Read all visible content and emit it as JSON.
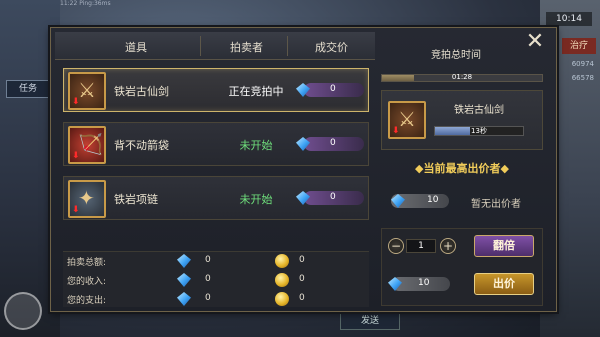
{
  "background": {
    "status_text": "11:22  Ping:36ms",
    "clock": "10:14",
    "side_button": "任务",
    "right_tab": "治疗",
    "num_a": "60974",
    "num_b": "66578",
    "send_label": "发送"
  },
  "table": {
    "columns": [
      "道具",
      "拍卖者",
      "成交价"
    ],
    "rows": [
      {
        "name": "铁岩古仙剑",
        "status": "正在竞拍中",
        "price": "0",
        "active": true
      },
      {
        "name": "背不动箭袋",
        "status": "未开始",
        "price": "0",
        "active": false
      },
      {
        "name": "铁岩项链",
        "status": "未开始",
        "price": "0",
        "active": false
      }
    ]
  },
  "summary": [
    {
      "label": "拍卖总额:",
      "gem": "0",
      "coin": "0"
    },
    {
      "label": "您的收入:",
      "gem": "0",
      "coin": "0"
    },
    {
      "label": "您的支出:",
      "gem": "0",
      "coin": "0"
    }
  ],
  "right": {
    "timer_title": "竞拍总时间",
    "timer_text": "01:28",
    "timer_fraction": 0.2,
    "current_item": "铁岩古仙剑",
    "seconds_text": "13秒",
    "seconds_fraction": 0.4,
    "highest_title": "◆当前最高出价者◆",
    "highest_price": "10",
    "no_bidder": "暂无出价者",
    "qty": "1",
    "double_label": "翻倍",
    "bid_price": "10",
    "bid_label": "出价"
  },
  "colors": {
    "accent_gold": "#cdb46b",
    "status_wait": "#6fe07c",
    "highest_title": "#f1cc5a"
  }
}
